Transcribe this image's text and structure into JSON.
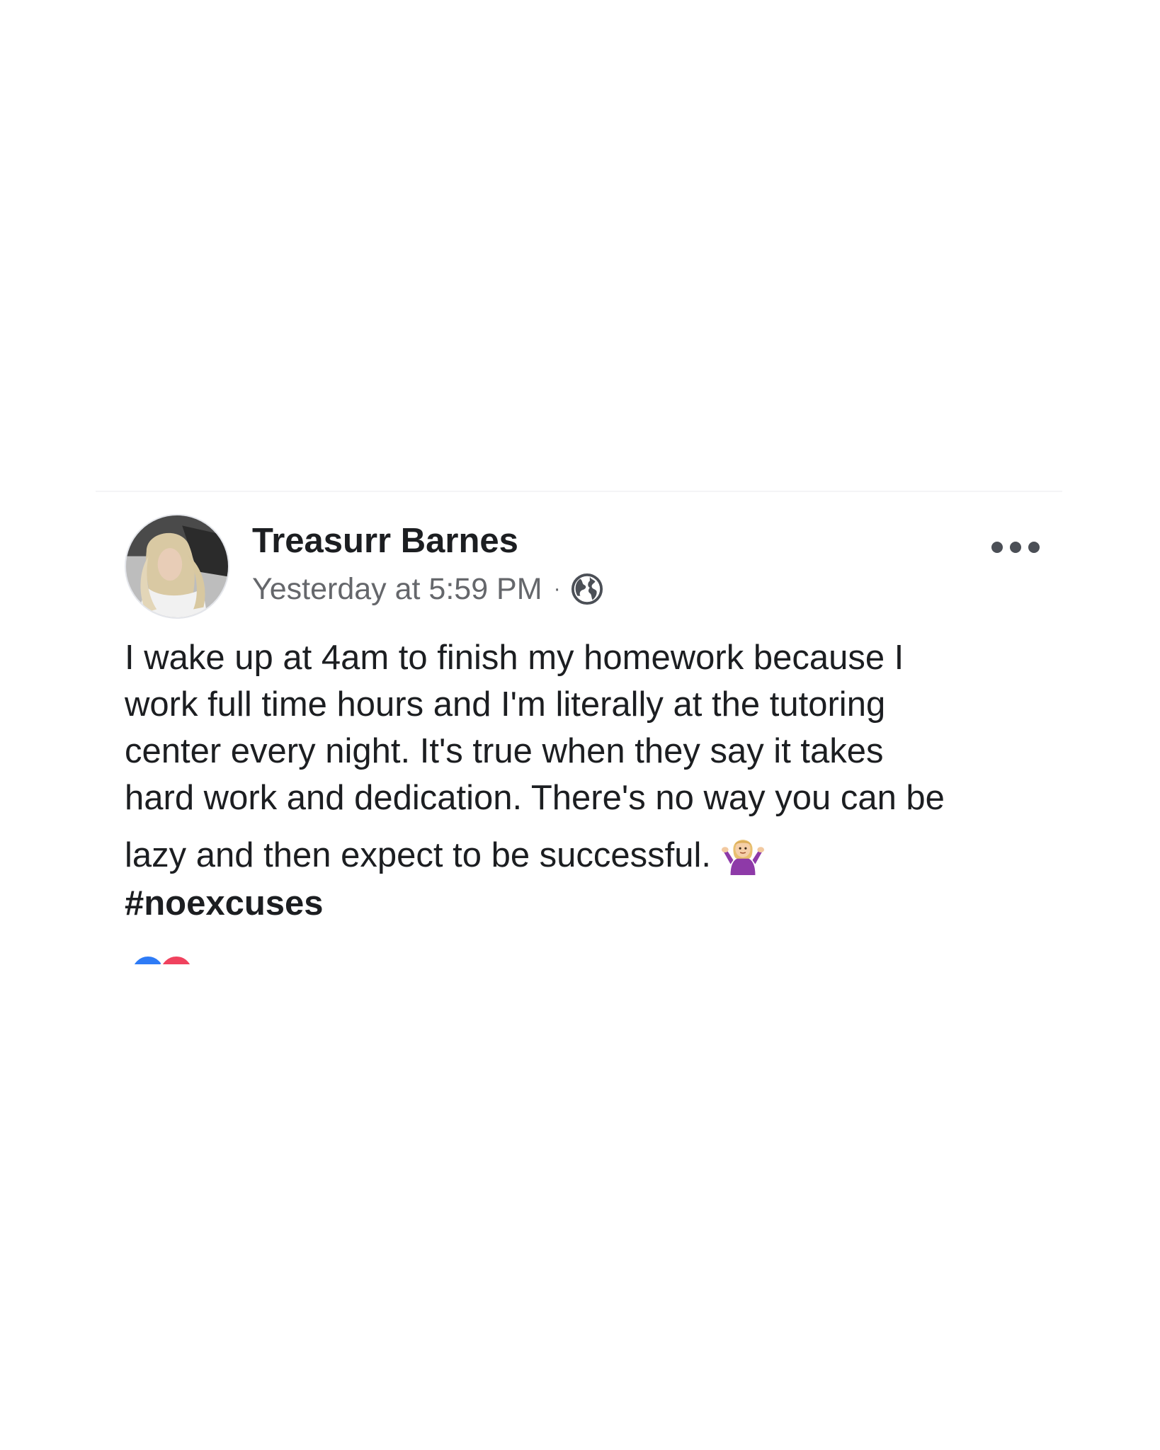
{
  "post": {
    "author": {
      "name": "Treasurr Barnes",
      "avatar_icon": "profile-photo"
    },
    "meta": {
      "timestamp": "Yesterday at 5:59 PM",
      "separator": "·",
      "audience_icon": "globe-icon"
    },
    "more_icon": "more-options-icon",
    "text_lines": [
      "I wake up at 4am to finish my homework because I",
      "work full time hours and I'm literally at the tutoring",
      "center every night. It's true when they say it takes",
      "hard work and dedication. There's no way you can be",
      "lazy and then expect to be successful."
    ],
    "emoji": "person-shrugging-emoji",
    "hashtag": "#noexcuses",
    "reactions": [
      {
        "type": "like",
        "color": "#2e7bf6"
      },
      {
        "type": "love",
        "color": "#f0425e"
      }
    ]
  },
  "colors": {
    "text_primary": "#1c1e21",
    "text_secondary": "#65676b",
    "background": "#ffffff"
  }
}
